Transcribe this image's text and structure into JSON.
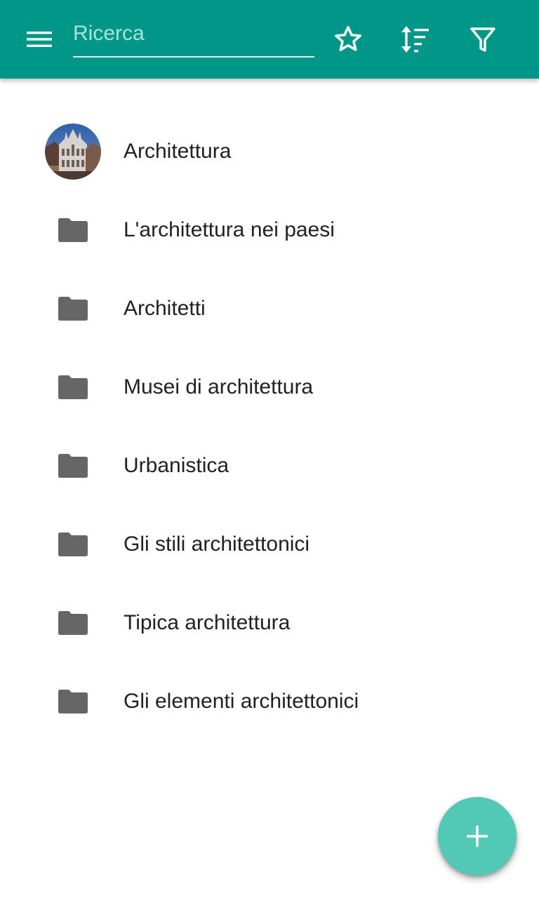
{
  "toolbar": {
    "menu_icon": "hamburger-menu-icon",
    "search_placeholder": "Ricerca",
    "search_value": "",
    "favorites_icon": "star-outline-icon",
    "sort_icon": "sort-icon",
    "filter_icon": "filter-icon",
    "background_color": "#009688"
  },
  "list": {
    "items": [
      {
        "label": "Architettura",
        "icon": "architecture-avatar-image"
      },
      {
        "label": "L'architettura nei paesi",
        "icon": "folder-icon"
      },
      {
        "label": "Architetti",
        "icon": "folder-icon"
      },
      {
        "label": "Musei di architettura",
        "icon": "folder-icon"
      },
      {
        "label": "Urbanistica",
        "icon": "folder-icon"
      },
      {
        "label": "Gli stili architettonici",
        "icon": "folder-icon"
      },
      {
        "label": "Tipica architettura",
        "icon": "folder-icon"
      },
      {
        "label": "Gli elementi architettonici",
        "icon": "folder-icon"
      }
    ]
  },
  "fab": {
    "icon": "plus-icon",
    "color": "#52c8b7"
  }
}
